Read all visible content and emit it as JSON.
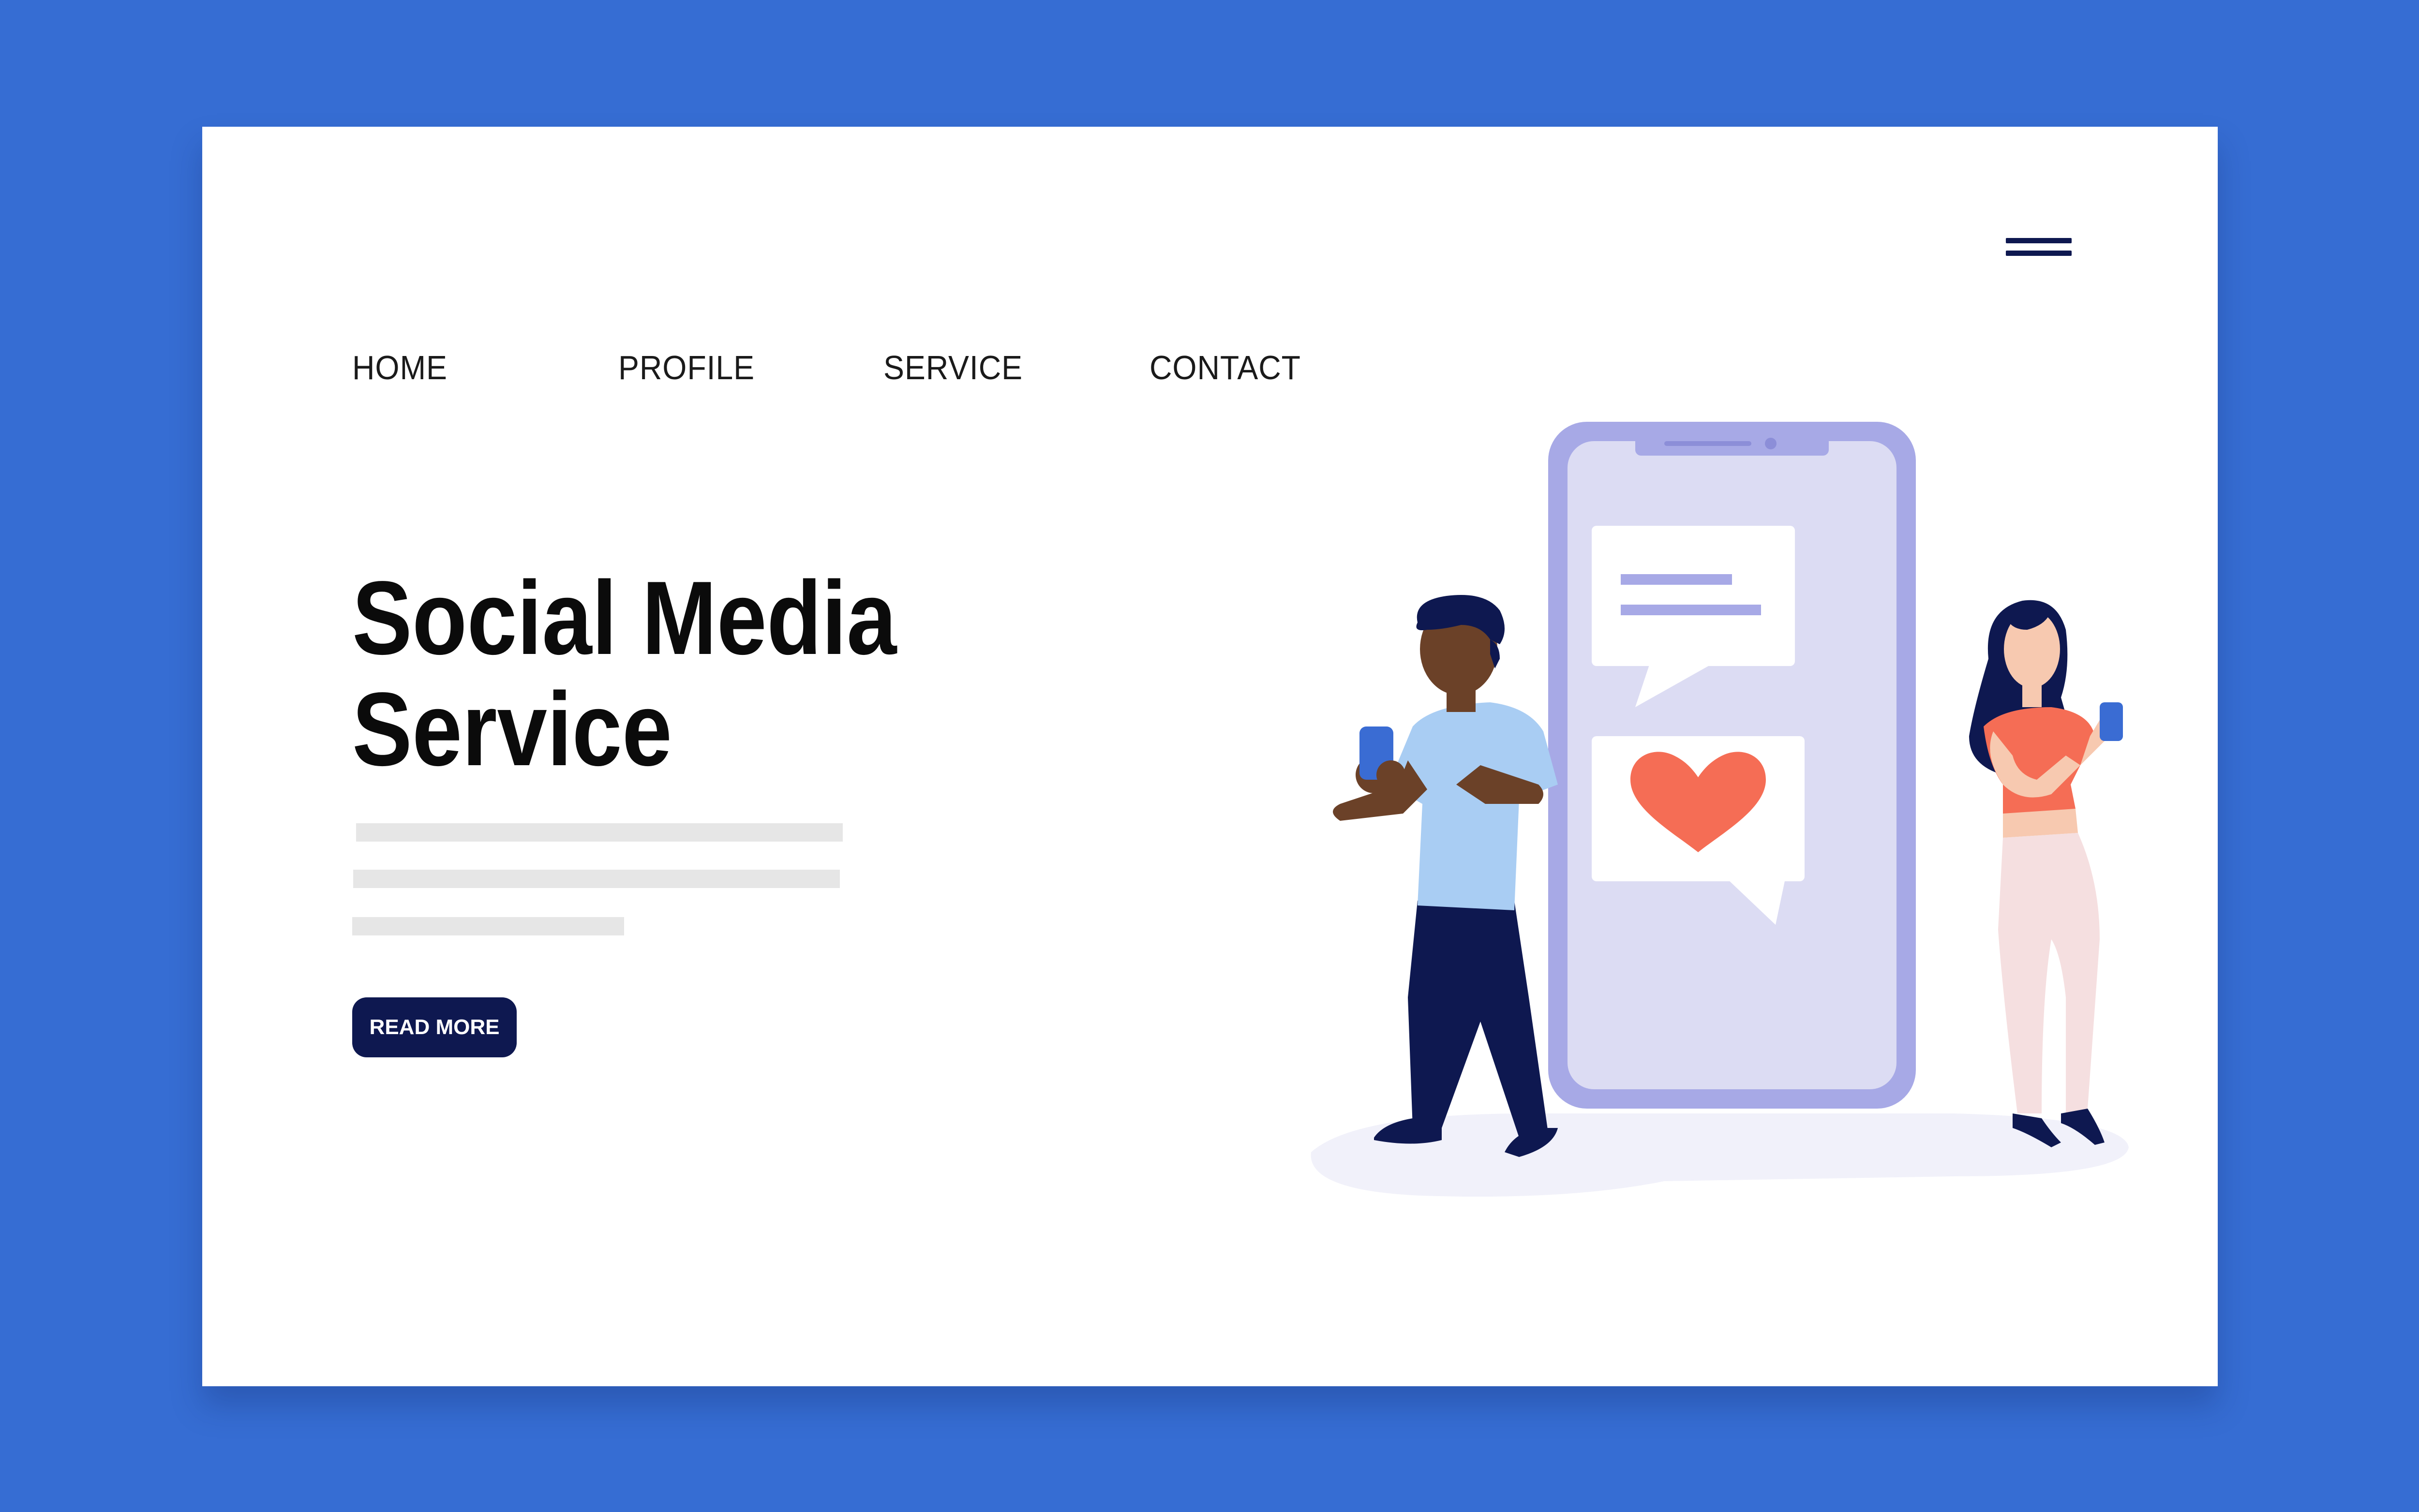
{
  "nav": {
    "items": [
      "HOME",
      "PROFILE",
      "SERVICE",
      "CONTACT"
    ]
  },
  "hero": {
    "title_line1": "Social Media",
    "title_line2": "Service",
    "button_label": "READ MORE"
  },
  "colors": {
    "background": "#366dd3",
    "card": "#ffffff",
    "navy": "#0e1850",
    "phone": "#a7a9e6",
    "heart": "#f56d55",
    "man_shirt": "#a9cdf3",
    "woman_top": "#f56d55"
  },
  "icons": [
    "hamburger-menu-icon",
    "heart-icon",
    "chat-bubble-icon"
  ]
}
